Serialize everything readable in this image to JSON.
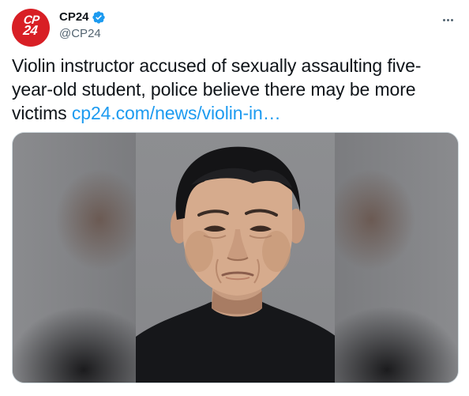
{
  "tweet": {
    "author": {
      "display_name": "CP24",
      "handle": "@CP24",
      "avatar_text_line1": "CP",
      "avatar_text_line2": "24",
      "verified": true,
      "avatar_color": "#d81f25",
      "verified_color": "#1d9bf0"
    },
    "text": "Violin instructor accused of sexually assaulting five-year-old student, police believe there may be more victims ",
    "link_text": "cp24.com/news/violin-in…",
    "link_color": "#1d9bf0",
    "media": {
      "type": "photo",
      "icon": "person-photo"
    },
    "more_icon": "more-horizontal-icon"
  }
}
